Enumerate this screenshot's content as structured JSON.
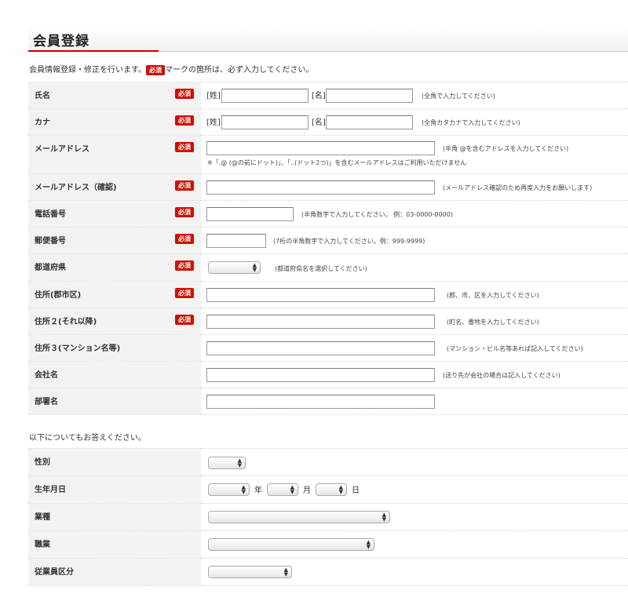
{
  "page": {
    "title": "会員登録",
    "intro_before": "会員情報登録・修正を行います。",
    "intro_badge": "必須",
    "intro_after": "マークの箇所は、必ず入力してください。",
    "section2_title": "以下についてもお答えください。"
  },
  "required_badge": "必須",
  "colors": {
    "accent": "#cc0000",
    "label_bg": "#f2f2f2"
  },
  "fields": {
    "name": {
      "label": "氏名",
      "sei_label": "[姓]",
      "mei_label": "[名]",
      "hint": "(全角で入力してください)",
      "sei_value": "",
      "mei_value": ""
    },
    "kana": {
      "label": "カナ",
      "sei_label": "[姓]",
      "mei_label": "[名]",
      "hint": "(全角カタカナで入力してください)",
      "sei_value": "",
      "mei_value": ""
    },
    "email": {
      "label": "メールアドレス",
      "hint": "(半角 @を含むアドレスを入力してください)",
      "note": "※「.@ (@の前にドット)」、「..(ドット2つ)」を含むメールアドレスはご利用いただけません",
      "value": ""
    },
    "email_confirm": {
      "label": "メールアドレス（確認)",
      "hint": "(メールアドレス確認のため再度入力をお願いします)",
      "value": ""
    },
    "phone": {
      "label": "電話番号",
      "hint": "(半角数字で入力してください。 例：03-0000-0000)",
      "value": ""
    },
    "zip": {
      "label": "郵便番号",
      "hint": "(7桁の半角数字で入力してください。例：999-9999)",
      "value": ""
    },
    "prefecture": {
      "label": "都道府県",
      "hint": "(都道府県名を選択してください)",
      "selected": ""
    },
    "address1": {
      "label": "住所(郡市区)",
      "hint": "(郡、市、区を入力してください)",
      "value": ""
    },
    "address2": {
      "label": "住所２(それ以降)",
      "hint": "(町名、番地を入力してください)",
      "value": ""
    },
    "address3": {
      "label": "住所３(マンション名等)",
      "hint": "(マンション・ビル名等あれば記入してください)",
      "value": ""
    },
    "company": {
      "label": "会社名",
      "hint": "(送り先が会社の場合は記入してください)",
      "value": ""
    },
    "department": {
      "label": "部署名",
      "value": ""
    }
  },
  "extra": {
    "gender": {
      "label": "性別",
      "selected": ""
    },
    "birthday": {
      "label": "生年月日",
      "year_unit": "年",
      "month_unit": "月",
      "day_unit": "日"
    },
    "industry": {
      "label": "業種",
      "selected": ""
    },
    "occupation": {
      "label": "職業",
      "selected": ""
    },
    "employees": {
      "label": "従業員区分",
      "selected": ""
    }
  }
}
